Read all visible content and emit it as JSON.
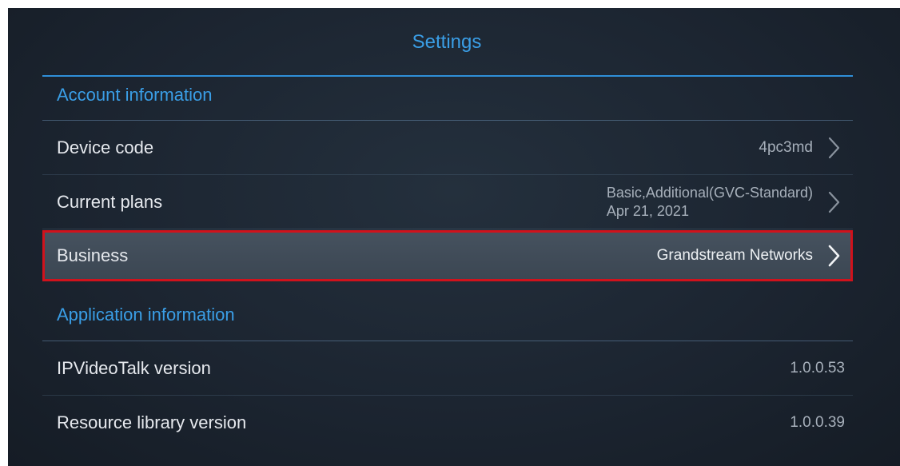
{
  "header": {
    "title": "Settings"
  },
  "account_section": {
    "heading": "Account information",
    "rows": [
      {
        "label": "Device code",
        "value": "4pc3md",
        "icon": "chevron-right-icon"
      },
      {
        "label": "Current plans",
        "value_line1": "Basic,Additional(GVC-Standard)",
        "value_line2": "Apr 21, 2021",
        "icon": "chevron-right-icon"
      },
      {
        "label": "Business",
        "value": "Grandstream Networks",
        "icon": "chevron-right-icon",
        "selected": true
      }
    ]
  },
  "application_section": {
    "heading": "Application information",
    "rows": [
      {
        "label": "IPVideoTalk version",
        "value": "1.0.0.53"
      },
      {
        "label": "Resource library version",
        "value": "1.0.0.39"
      }
    ]
  },
  "colors": {
    "accent": "#3a9ee6",
    "highlight_border": "#d0121c",
    "background": "#1c2531"
  }
}
